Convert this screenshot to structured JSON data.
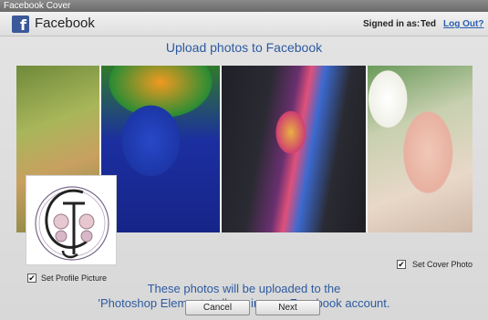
{
  "window": {
    "title": "Facebook Cover"
  },
  "header": {
    "app_name": "Facebook",
    "logo_letter": "f",
    "signed_in_label": "Signed in as:",
    "user": "Ted",
    "logout_label": "Log Out?"
  },
  "main": {
    "headline": "Upload photos to Facebook",
    "set_profile_label": "Set Profile Picture",
    "set_profile_checked": true,
    "set_cover_label": "Set Cover Photo",
    "set_cover_checked": true,
    "info_line1": "These photos will be uploaded to the",
    "info_line2": "'Photoshop Elements' album in your Facebook account."
  },
  "buttons": {
    "cancel_label": "Cancel",
    "next_label": "Next"
  },
  "colors": {
    "accent_text": "#2c5aa0",
    "facebook_blue": "#3b5998",
    "link": "#2a5fb0"
  }
}
